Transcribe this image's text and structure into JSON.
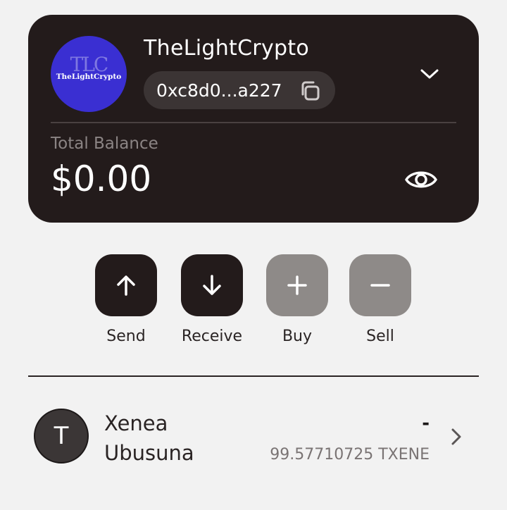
{
  "wallet": {
    "name": "TheLightCrypto",
    "avatar_monogram": "TLC",
    "avatar_brand": "TheLightCrypto",
    "address": "0xc8d0...a227",
    "balance_label": "Total Balance",
    "balance": "$0.00"
  },
  "actions": [
    {
      "label": "Send",
      "icon": "arrow-up-icon"
    },
    {
      "label": "Receive",
      "icon": "arrow-down-icon"
    },
    {
      "label": "Buy",
      "icon": "plus-icon"
    },
    {
      "label": "Sell",
      "icon": "minus-icon"
    }
  ],
  "tokens": [
    {
      "initial": "T",
      "name": "Xenea Ubusuna",
      "value": "-",
      "amount": "99.57710725 TXENE"
    }
  ],
  "colors": {
    "card_bg": "#231b1b",
    "avatar_bg": "#3a2fd2",
    "action_dark": "#231b1b",
    "action_disabled": "#8e8a88",
    "page_bg": "#f2f2f2"
  }
}
